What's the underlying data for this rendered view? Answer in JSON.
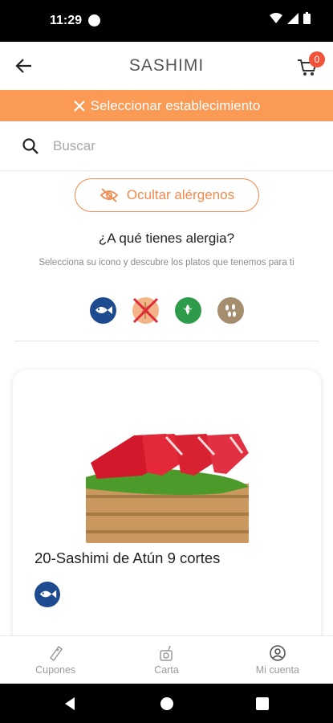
{
  "status_bar": {
    "time": "11:29"
  },
  "header": {
    "title": "SASHIMI",
    "cart_count": "0"
  },
  "establishment": {
    "label": "Seleccionar establecimiento"
  },
  "search": {
    "placeholder": "Buscar",
    "value": ""
  },
  "allergens_section": {
    "toggle_label": "Ocultar alérgenos",
    "question": "¿A qué tienes alergia?",
    "hint": "Selecciona su icono y descubre los platos que tenemos para ti",
    "icons": [
      "fish-allergen-icon",
      "gluten-allergen-icon-crossed",
      "celery-allergen-icon",
      "sesame-allergen-icon"
    ]
  },
  "product": {
    "name": "20-Sashimi de Atún 9 cortes",
    "allergen_icon": "fish-allergen-icon"
  },
  "bottom_nav": {
    "items": [
      {
        "label": "Cupones",
        "icon": "coupon-icon"
      },
      {
        "label": "Carta",
        "icon": "menu-icon"
      },
      {
        "label": "Mi cuenta",
        "icon": "account-icon"
      }
    ]
  },
  "colors": {
    "accent": "#fa9a55",
    "accent_outline": "#f08a4b",
    "badge": "#f0523a",
    "fish_icon": "#1e4b8f",
    "celery_icon": "#2e9b4a",
    "sesame_icon": "#a58e6d"
  }
}
